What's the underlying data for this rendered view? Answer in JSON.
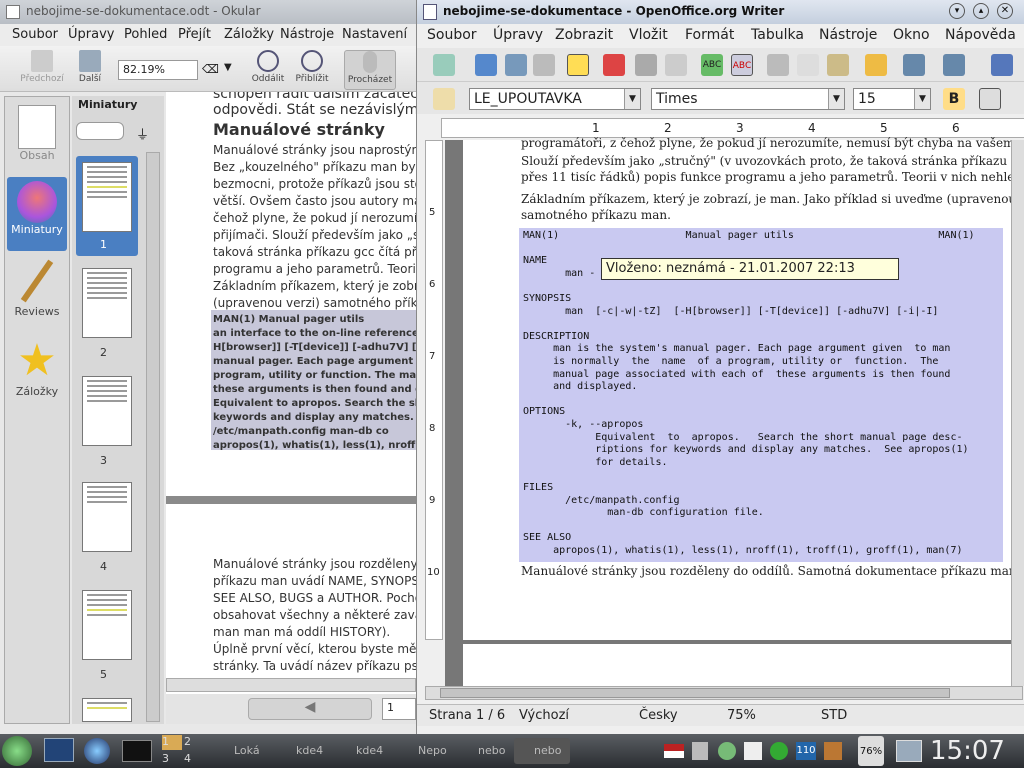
{
  "okular": {
    "title": "nebojime-se-dokumentace.odt - Okular",
    "menu": [
      "Soubor",
      "Úpravy",
      "Pohled",
      "Přejít",
      "Záložky",
      "Nástroje",
      "Nastavení"
    ],
    "toolbar": {
      "prev": "Předchozí",
      "next": "Další",
      "zoom": "82.19%",
      "zoom_out": "Oddálit",
      "zoom_in": "Přiblížit",
      "browse": "Procházet"
    },
    "sidebar": [
      "Obsah",
      "Miniatury",
      "Reviews",
      "Záložky"
    ],
    "thumbs_title": "Miniatury",
    "thumb_numbers": [
      "1",
      "2",
      "3",
      "4",
      "5"
    ],
    "page_number": "1",
    "doc": {
      "lines1": [
        "schopen radit dalším začátečníkům, najít",
        "odpovědi. Stát se nezávislým n"
      ],
      "heading": "Manuálové stránky",
      "para": [
        "Manuálové stránky jsou naprostým zá",
        "Bez „kouzelného\" příkazu man by byl",
        "bezmocni, protože příkazů jsou stovk",
        "větší. Ovšem často jsou autory manu",
        "čehož plyne, že pokud jí nerozumíte,",
        "přijímači. Slouží především jako „struč",
        "taková stránka příkazu gcc čítá přes 1",
        "programu a jeho parametrů. Teorii v n",
        "Základním příkazem, který je zobrazí",
        "(upravenou verzi) samotného příkazu"
      ],
      "man": [
        "MAN(1)              Manual pager utils",
        "an interface to the on-line reference man",
        "H[browser]] [-T[device]] [-adhu7V] [-i|-I]D",
        "manual pager. Each page argument give",
        "program, utility or function. The     man",
        "these arguments is then found    and d",
        "Equivalent to apropos.    Search the sho",
        "keywords and display any matches. Se",
        "/etc/manpath.config             man-db co",
        "apropos(1), whatis(1), less(1), nroff(1), tr"
      ],
      "lines2": [
        "Manuálové stránky jsou rozděleny do",
        "příkazu man uvádí NAME, SYNOPSIS,",
        "SEE ALSO, BUGS a AUTHOR. Pochopi",
        "obsahovat všechny a některé zaváděj",
        "man man má oddíl HISTORY).",
        "Úplně první věcí, kterou byste měli př",
        "stránky. Ta uvádí název příkazu psan"
      ]
    }
  },
  "writer": {
    "title": "nebojime-se-dokumentace - OpenOffice.org Writer",
    "menu": [
      "Soubor",
      "Úpravy",
      "Zobrazit",
      "Vložit",
      "Formát",
      "Tabulka",
      "Nástroje",
      "Okno",
      "Nápověda"
    ],
    "style": "LE_UPOUTAVKA",
    "font": "Times",
    "size": "15",
    "ruler_marks": [
      "1",
      "2",
      "3",
      "4",
      "5",
      "6"
    ],
    "vruler_marks": [
      "5",
      "6",
      "7",
      "8",
      "9",
      "10"
    ],
    "text_top": [
      "programátoři, z čehož plyne, že pokud jí nerozumíte, nemusí být chyba na vašem přijímači.",
      "Slouží především jako „stručný\" (v uvozovkách proto, že taková stránka příkazu gcc čítá",
      "přes 11 tisíc řádků) popis funkce programu a jeho parametrů. Teorii v nich nehledejte.",
      "Základním příkazem, který je zobrazí, je man. Jako příklad si uveďme (upravenou verzi)",
      "samotného příkazu man."
    ],
    "man_lines": [
      "MAN(1)                     Manual pager utils                        MAN(1)",
      "",
      "NAME",
      "       man - an interface to the on-line reference manuals",
      "",
      "SYNOPSIS",
      "       man  [-c|-w|-tZ]  [-H[browser]] [-T[device]] [-adhu7V] [-i|-I]",
      "",
      "DESCRIPTION",
      "     man is the system's manual pager. Each page argument given  to man",
      "     is normally  the  name  of a program, utility or  function.  The",
      "     manual page associated with each of  these arguments is then found",
      "     and displayed.",
      "",
      "OPTIONS",
      "       -k, --apropos",
      "            Equivalent  to  apropos.   Search the short manual page desc-",
      "            riptions for keywords and display any matches.  See apropos(1)",
      "            for details.",
      "",
      "FILES",
      "       /etc/manpath.config",
      "              man-db configuration file.",
      "",
      "SEE ALSO",
      "     apropos(1), whatis(1), less(1), nroff(1), troff(1), groff(1), man(7)"
    ],
    "text_bottom": "Manuálové stránky jsou rozděleny do oddílů. Samotná dokumentace příkazu man uvádí",
    "tooltip": "Vloženo: neznámá - 21.01.2007 22:13",
    "status": {
      "page": "Strana 1 / 6",
      "style": "Výchozí",
      "lang": "Česky",
      "zoom": "75%",
      "mode": "STD"
    }
  },
  "taskbar": {
    "desktops": [
      "1",
      "2",
      "3",
      "4"
    ],
    "tasks": [
      "Loká",
      "kde4",
      "kde4",
      "Nepo",
      "nebo",
      "nebo"
    ],
    "tray_number": "110",
    "battery": "76%",
    "clock": "15:07"
  },
  "colors": {
    "highlight": "#c9c9f1",
    "tooltip": "#ffffdc",
    "taskbar": "#2a2d31"
  }
}
